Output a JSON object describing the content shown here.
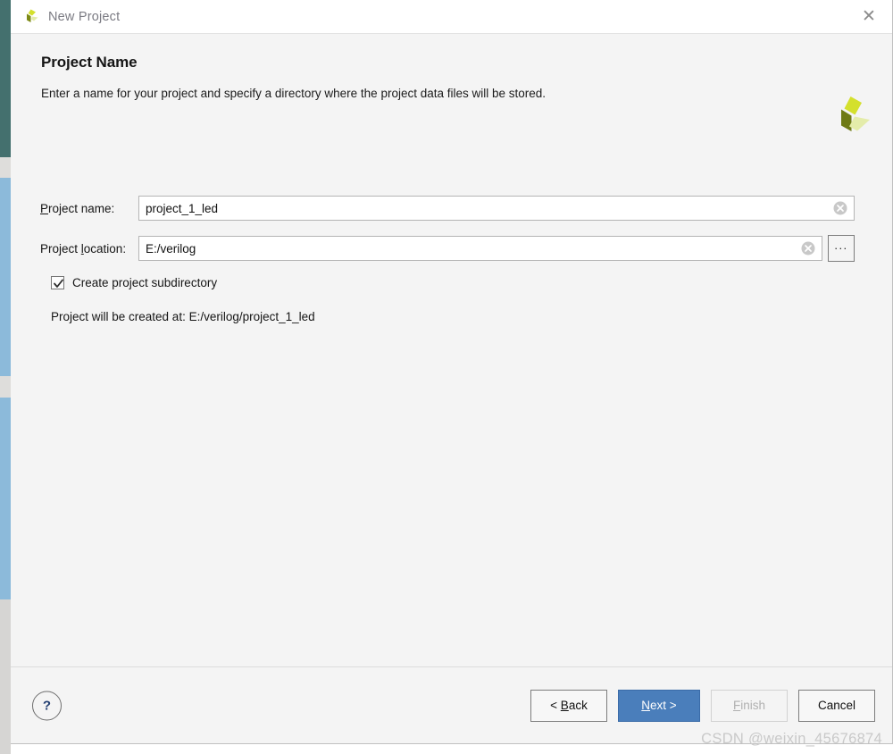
{
  "window": {
    "title": "New Project",
    "logo_icon": "xilinx-logo-icon",
    "close_icon": "close-icon"
  },
  "header": {
    "title": "Project Name",
    "subtitle": "Enter a name for your project and specify a directory where the project data files will be stored.",
    "brand_logo_icon": "xilinx-tri-lobe-logo-icon"
  },
  "form": {
    "project_name": {
      "label_prefix": "",
      "label_mnemonic": "P",
      "label_suffix": "roject name:",
      "value": "project_1_led",
      "placeholder": "",
      "clear_icon": "clear-circle-icon"
    },
    "project_location": {
      "label_prefix": "Project ",
      "label_mnemonic": "l",
      "label_suffix": "ocation:",
      "value": "E:/verilog",
      "placeholder": "",
      "clear_icon": "clear-circle-icon",
      "browse_label": "...",
      "browse_icon": "ellipsis-icon"
    },
    "create_subdirectory": {
      "label": "Create project subdirectory",
      "checked": true,
      "check_icon": "checkmark-icon"
    },
    "created_at_text": "Project will be created at: E:/verilog/project_1_led"
  },
  "footer": {
    "help_label": "?",
    "help_icon": "question-mark-icon",
    "buttons": [
      {
        "id": "back",
        "prefix": "< ",
        "mnemonic": "B",
        "suffix": "ack",
        "state": "enabled"
      },
      {
        "id": "next",
        "prefix": "",
        "mnemonic": "N",
        "suffix": "ext >",
        "state": "primary"
      },
      {
        "id": "finish",
        "prefix": "",
        "mnemonic": "F",
        "suffix": "inish",
        "state": "disabled"
      },
      {
        "id": "cancel",
        "prefix": "Cancel",
        "mnemonic": "",
        "suffix": "",
        "state": "enabled"
      }
    ]
  },
  "watermark": {
    "text": "CSDN @weixin_45676874"
  },
  "colors": {
    "accent_blue": "#4a7ebb",
    "help_blue": "#233f72",
    "dialog_bg": "#f4f4f4",
    "bg_teal": "#44706e",
    "bg_light_blue": "#8cbada",
    "logo_dark": "#6e7a14",
    "logo_bright": "#d4e02c",
    "logo_pale": "#e4ecaa"
  }
}
